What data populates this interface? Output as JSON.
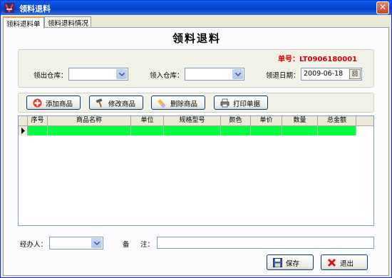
{
  "window": {
    "title": "领料退料",
    "close_label": "✕"
  },
  "tabs": [
    {
      "label": "领料退料单",
      "active": true
    },
    {
      "label": "领料退料情况",
      "active": false
    }
  ],
  "page_title": "领料退料",
  "order": {
    "label": "单号：",
    "value": "LT0906180001"
  },
  "header_fields": {
    "out_warehouse": {
      "label": "领出仓库：",
      "value": ""
    },
    "in_warehouse": {
      "label": "领入仓库：",
      "value": ""
    },
    "return_date": {
      "label": "领退日期：",
      "value": "2009-06-18",
      "button": "回"
    }
  },
  "toolbar": {
    "add": "添加商品",
    "edit": "修改商品",
    "delete": "删除商品",
    "print": "打印单据"
  },
  "grid": {
    "columns": [
      "序号",
      "商品名称",
      "单位",
      "规格型号",
      "颜色",
      "单价",
      "数量",
      "总金额"
    ],
    "rows": [
      [
        "",
        "",
        "",
        "",
        "",
        "",
        "",
        ""
      ]
    ]
  },
  "footer": {
    "handler": {
      "label": "经办人：",
      "value": ""
    },
    "note": {
      "label1": "备",
      "label2": "注：",
      "value": ""
    },
    "save": "保存",
    "exit": "退出"
  },
  "colors": {
    "accent": "#d40000",
    "row_highlight": "#00ff40",
    "titlebar": "#0848d4"
  }
}
